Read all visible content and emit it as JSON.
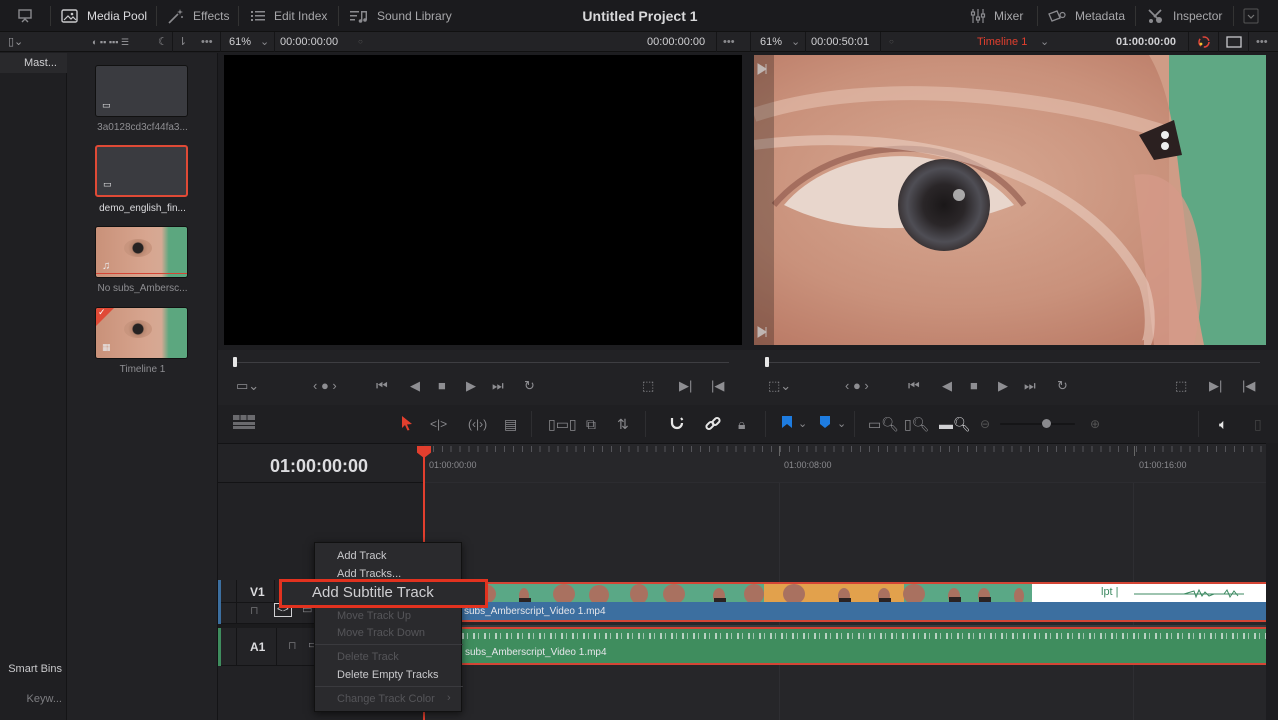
{
  "topbar": {
    "tabs": [
      {
        "label": "Media Pool",
        "icon": "media-pool-icon",
        "active": true
      },
      {
        "label": "Effects",
        "icon": "effects-wand-icon"
      },
      {
        "label": "Edit Index",
        "icon": "list-icon"
      },
      {
        "label": "Sound Library",
        "icon": "music-list-icon"
      }
    ],
    "project_title": "Untitled Project 1",
    "right_tabs": [
      {
        "label": "Mixer",
        "icon": "mixer-icon"
      },
      {
        "label": "Metadata",
        "icon": "metadata-tag-icon"
      },
      {
        "label": "Inspector",
        "icon": "inspector-tools-icon"
      }
    ]
  },
  "subbar": {
    "source_zoom": "61%",
    "source_timecode_left": "00:00:00:00",
    "source_timecode_right": "00:00:00:00",
    "timeline_zoom": "61%",
    "timeline_duration": "00:00:50:01",
    "timeline_name": "Timeline 1",
    "timeline_timecode": "01:00:00:00"
  },
  "bins": {
    "master": "Mast...",
    "smart_bins": "Smart Bins",
    "keywords": "Keyw..."
  },
  "media_pool": {
    "clips": [
      {
        "name": "3a0128cd3cf44fa3...",
        "type": "subtitle",
        "selected": false
      },
      {
        "name": "demo_english_fin...",
        "type": "subtitle",
        "selected": true
      },
      {
        "name": "No subs_Ambersc...",
        "type": "audio-video",
        "selected": false
      },
      {
        "name": "Timeline 1",
        "type": "timeline",
        "selected": false
      }
    ]
  },
  "timeline": {
    "current_timecode": "01:00:00:00",
    "ruler_labels": [
      "01:00:00:00",
      "01:00:08:00",
      "01:00:16:00"
    ],
    "tracks": [
      {
        "name": "V1",
        "clip": "subs_Amberscript_Video 1.mp4",
        "color": "#3c6fa0"
      },
      {
        "name": "A1",
        "clip": "subs_Amberscript_Video 1.mp4",
        "color": "#3f8d5e"
      }
    ],
    "end_clip_text": "lpt |"
  },
  "context_menu": {
    "items": [
      {
        "label": "Add Track",
        "enabled": true
      },
      {
        "label": "Add Tracks...",
        "enabled": true
      },
      {
        "label": "Add Subtitle Track",
        "enabled": true,
        "highlighted": true
      },
      {
        "label": "Move Track Up",
        "enabled": false
      },
      {
        "label": "Move Track Down",
        "enabled": false
      },
      {
        "label": "Delete Track",
        "enabled": false
      },
      {
        "label": "Delete Empty Tracks",
        "enabled": true
      },
      {
        "label": "Change Track Color",
        "enabled": false,
        "submenu": true
      }
    ]
  },
  "colors": {
    "accent_red": "#e23f2e",
    "video_clip": "#3c6fa0",
    "audio_clip": "#3f8d5e",
    "flag_blue": "#1e7ce0"
  }
}
